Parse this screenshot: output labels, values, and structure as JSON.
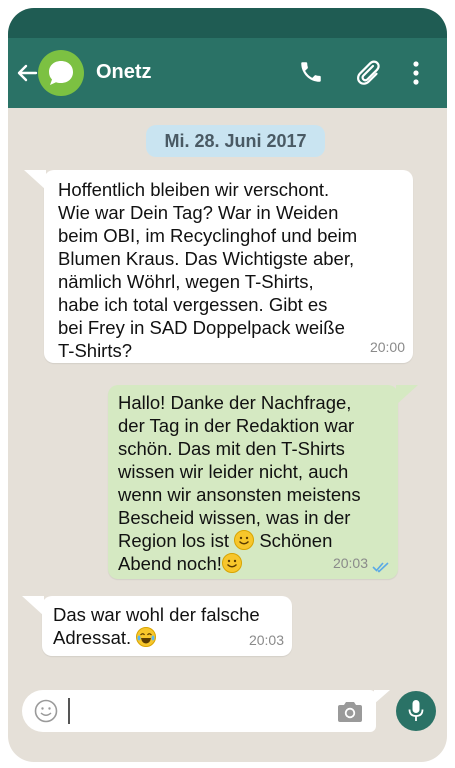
{
  "header": {
    "contact_name": "Onetz"
  },
  "date_chip": "Mi. 28. Juni 2017",
  "messages": [
    {
      "direction": "incoming",
      "text": "Hoffentlich bleiben wir verschont.\nWie war Dein Tag? War in Weiden\nbeim OBI, im Recyclinghof und beim\nBlumen Kraus. Das Wichtigste aber,\nnämlich Wöhrl, wegen T-Shirts,\nhabe ich total vergessen. Gibt es\nbei Frey in SAD Doppelpack weiße\nT-Shirts?",
      "time": "20:00"
    },
    {
      "direction": "outgoing",
      "text_part1": "Hallo! Danke der Nachfrage,\nder Tag in der Redaktion war\nschön. Das mit den T-Shirts\nwissen wir leider nicht, auch\nwenn wir ansonsten meistens\nBescheid wissen, was in der\nRegion los ist",
      "text_part2": "Schönen\nAbend noch!",
      "emoji1": "smiling-face",
      "emoji2": "smiling-face",
      "time": "20:03",
      "status": "read-double-check"
    },
    {
      "direction": "incoming",
      "text": "Das war wohl der falsche\nAdressat.",
      "emoji": "tears-of-joy-face",
      "time": "20:03"
    }
  ],
  "input": {
    "placeholder": ""
  },
  "colors": {
    "header": "#2a7266",
    "statusbar": "#1f5c53",
    "background": "#e5e0d8",
    "outgoing_bubble": "#d5e9c2",
    "incoming_bubble": "#ffffff",
    "date_chip": "#c9e4f1",
    "avatar": "#7cc142",
    "read_check": "#5aa9e6"
  }
}
